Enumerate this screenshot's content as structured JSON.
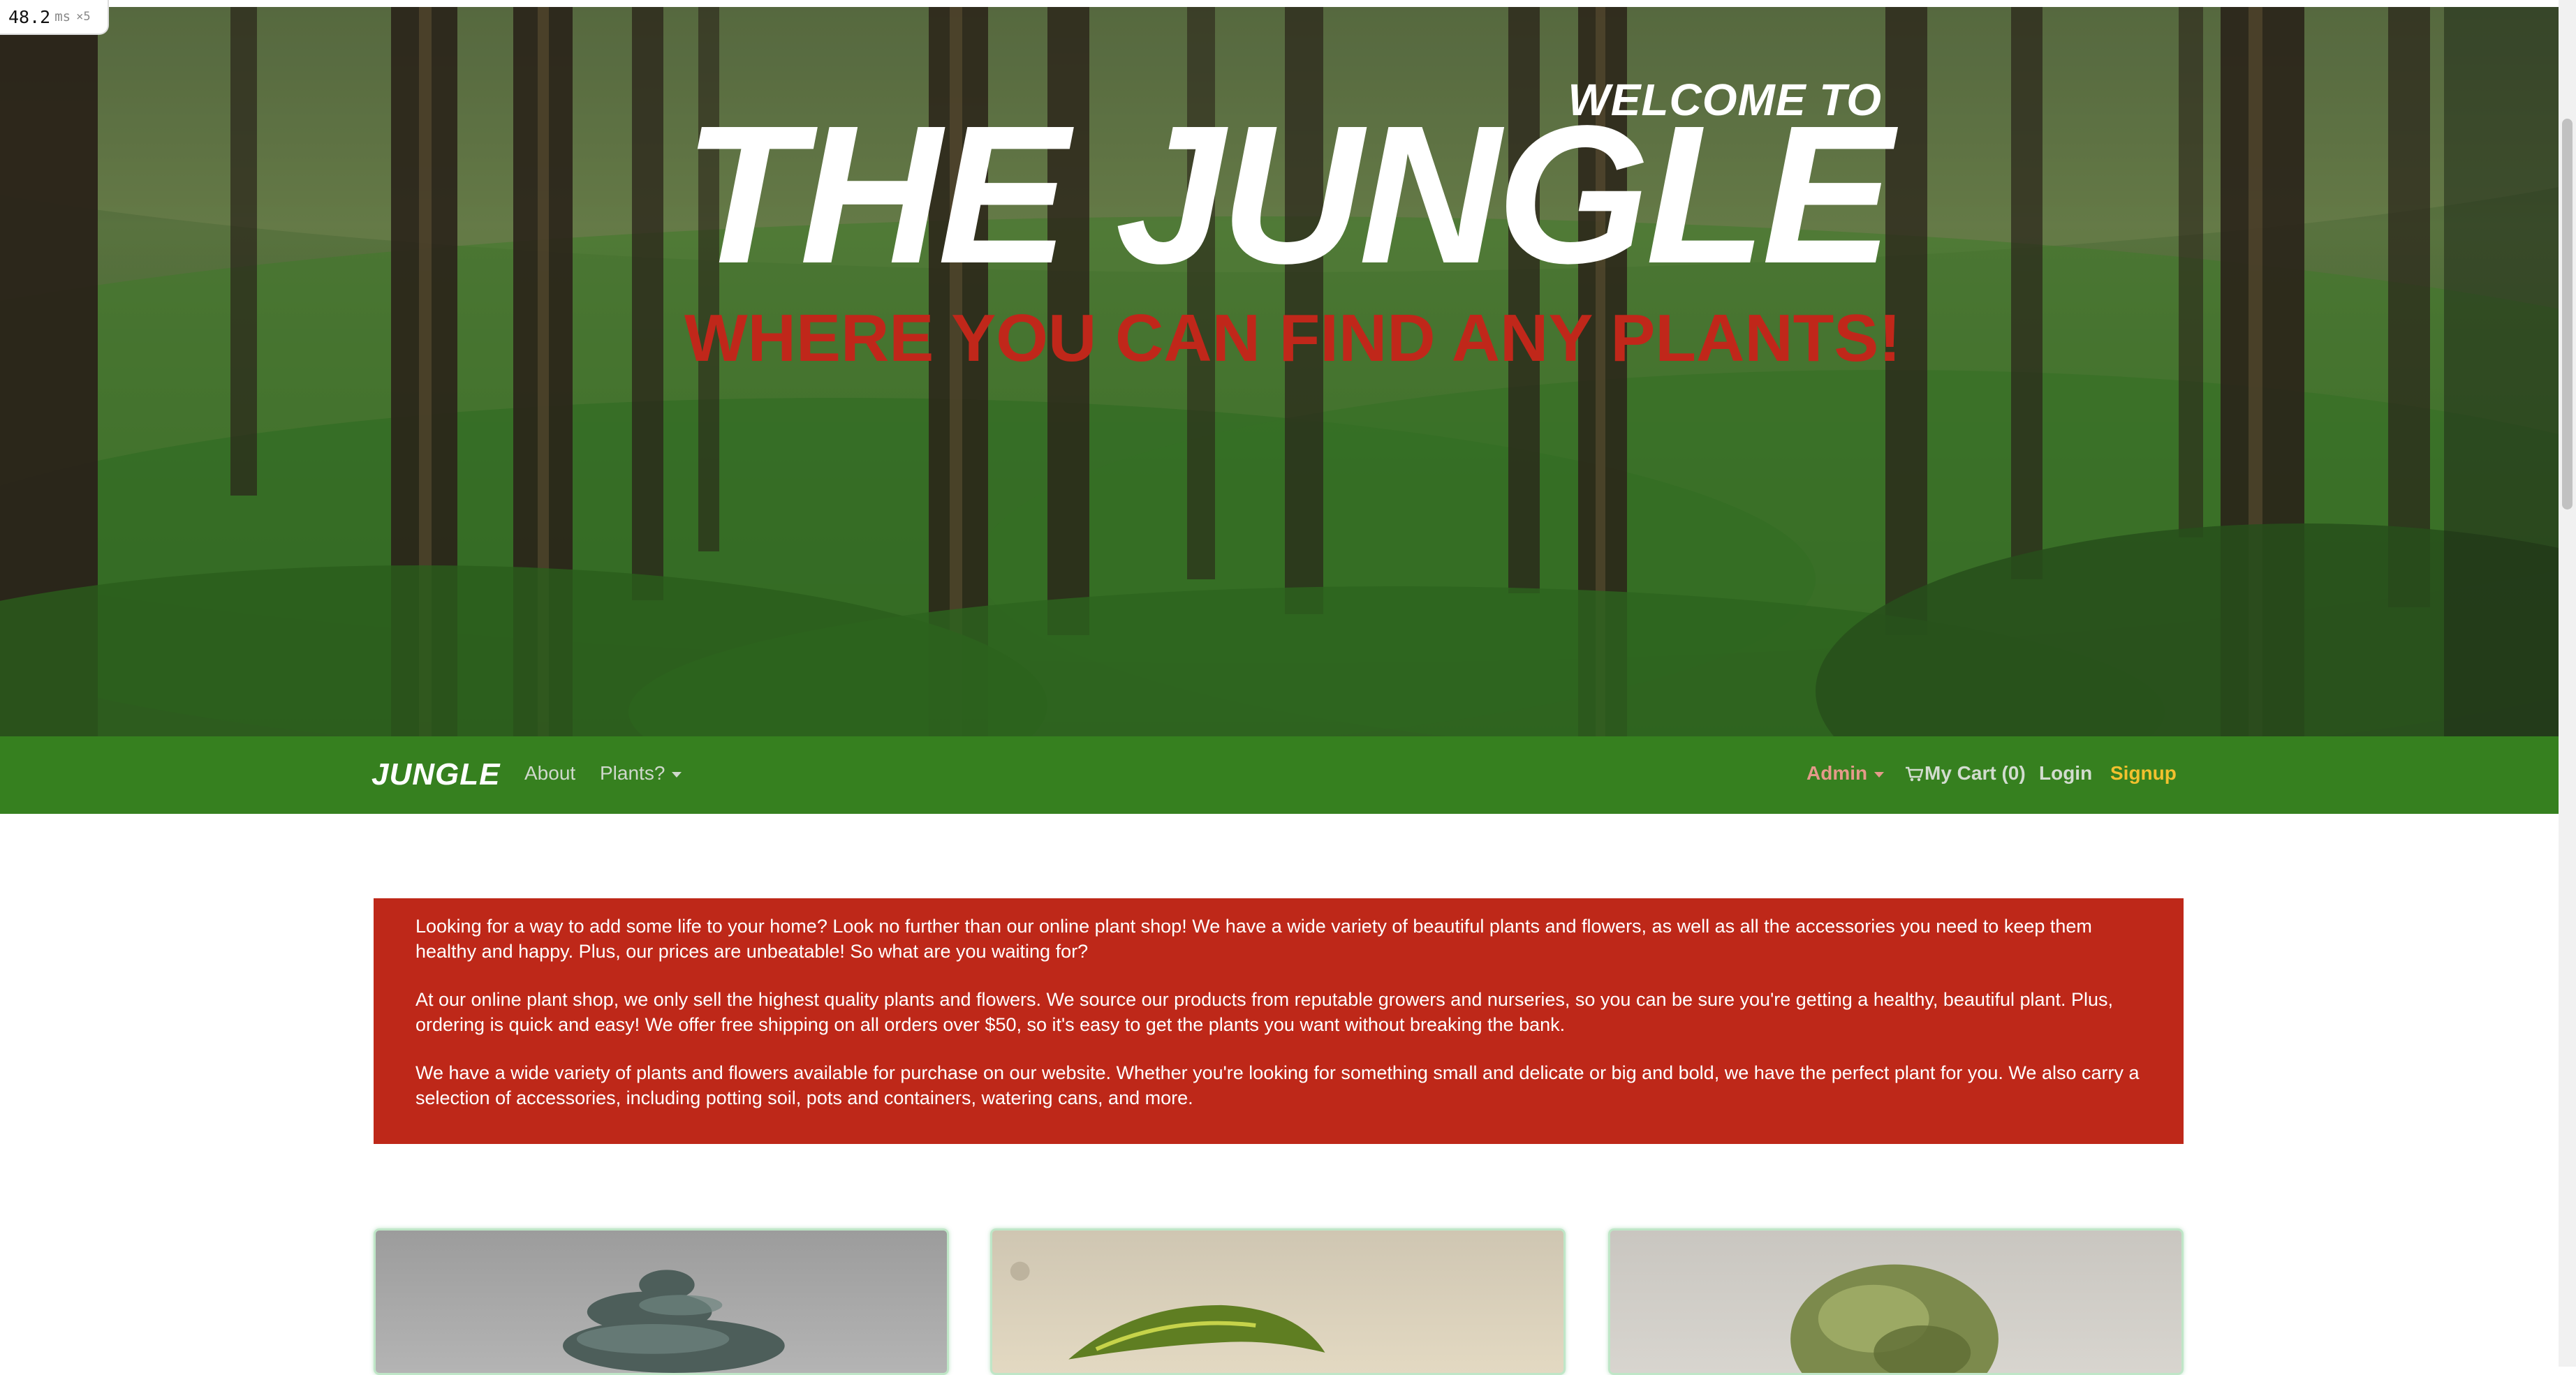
{
  "perf": {
    "value": "48.2",
    "unit": "ms",
    "multiplier": "×5"
  },
  "hero": {
    "welcome": "WELCOME TO",
    "title": "THE JUNGLE",
    "tagline": "WHERE YOU CAN FIND ANY PLANTS!"
  },
  "navbar": {
    "brand": "JUNGLE",
    "about": "About",
    "plants": "Plants?",
    "admin": "Admin",
    "cart": "My Cart (0)",
    "login": "Login",
    "signup": "Signup",
    "colors": {
      "background": "#36801f",
      "admin": "#e59a8a",
      "signup": "#f2c12e"
    }
  },
  "about": {
    "paragraphs": [
      "Looking for a way to add some life to your home? Look no further than our online plant shop! We have a wide variety of beautiful plants and flowers, as well as all the accessories you need to keep them healthy and happy. Plus, our prices are unbeatable! So what are you waiting for?",
      "At our online plant shop, we only sell the highest quality plants and flowers. We source our products from reputable growers and nurseries, so you can be sure you're getting a healthy, beautiful plant. Plus, ordering is quick and easy! We offer free shipping on all orders over $50, so it's easy to get the plants you want without breaking the bank.",
      "We have a wide variety of plants and flowers available for purchase on our website. Whether you're looking for something small and delicate or big and bold, we have the perfect plant for you. We also carry a selection of accessories, including potting soil, pots and containers, watering cans, and more."
    ],
    "background": "#be2819"
  },
  "products": {
    "cards": [
      {
        "image": "bonsai-tree-image"
      },
      {
        "image": "leafy-plant-image"
      },
      {
        "image": "round-bonsai-image"
      }
    ]
  }
}
